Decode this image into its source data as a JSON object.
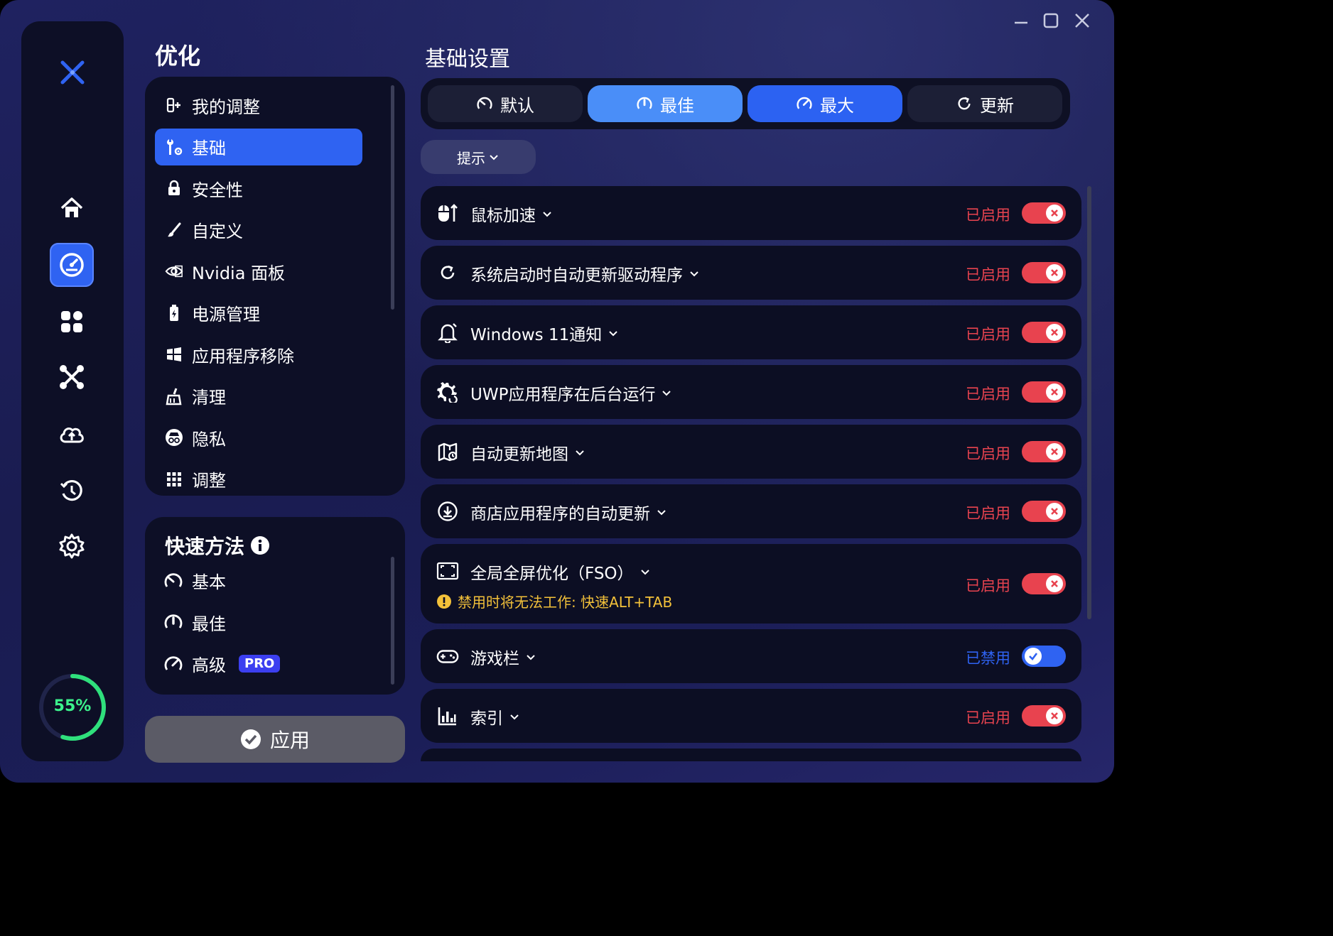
{
  "app": {
    "window_controls": [
      "minimize-icon",
      "maximize-icon",
      "close-icon"
    ],
    "accent_color": "#2f63f2",
    "enabled_color": "#e8434f",
    "disabled_color": "#2f63f2",
    "warning_color": "#f3c13a"
  },
  "rail": {
    "items": [
      "home-icon",
      "speedometer-icon",
      "apps-icon",
      "tools-icon",
      "cloud-icon",
      "restore-icon",
      "settings-icon"
    ],
    "active_item": "speedometer-icon",
    "score_percent": 55,
    "score_label": "55%"
  },
  "optimize": {
    "title": "优化",
    "items": [
      {
        "label": "我的调整",
        "icon": "my-tweaks-icon"
      },
      {
        "label": "基础",
        "icon": "wrench-gear-icon",
        "active": true
      },
      {
        "label": "安全性",
        "icon": "lock-icon"
      },
      {
        "label": "自定义",
        "icon": "brush-icon"
      },
      {
        "label": "Nvidia 面板",
        "icon": "nvidia-icon"
      },
      {
        "label": "电源管理",
        "icon": "battery-icon"
      },
      {
        "label": "应用程序移除",
        "icon": "windows-icon"
      },
      {
        "label": "清理",
        "icon": "broom-icon"
      },
      {
        "label": "隐私",
        "icon": "incognito-icon"
      },
      {
        "label": "调整",
        "icon": "grid-icon"
      }
    ]
  },
  "quick": {
    "title": "快速方法",
    "items": [
      {
        "label": "基本",
        "icon": "gauge-low-icon"
      },
      {
        "label": "最佳",
        "icon": "gauge-mid-icon"
      },
      {
        "label": "高级",
        "icon": "gauge-high-icon",
        "badge": "PRO"
      }
    ]
  },
  "apply_label": "应用",
  "main": {
    "title": "基础设置",
    "presets": [
      {
        "label": "默认",
        "icon": "gauge-low-icon"
      },
      {
        "label": "最佳",
        "icon": "gauge-mid-icon"
      },
      {
        "label": "最大",
        "icon": "gauge-high-icon"
      },
      {
        "label": "更新",
        "icon": "refresh-icon"
      }
    ],
    "tips_label": "提示",
    "settings": [
      {
        "label": "鼠标加速",
        "icon": "mouse-icon",
        "status": "已启用",
        "enabled": true
      },
      {
        "label": "系统启动时自动更新驱动程序",
        "icon": "refresh-icon",
        "status": "已启用",
        "enabled": true
      },
      {
        "label": "Windows 11通知",
        "icon": "bell-icon",
        "status": "已启用",
        "enabled": true
      },
      {
        "label": "UWP应用程序在后台运行",
        "icon": "gear-refresh-icon",
        "status": "已启用",
        "enabled": true
      },
      {
        "label": "自动更新地图",
        "icon": "map-icon",
        "status": "已启用",
        "enabled": true
      },
      {
        "label": "商店应用程序的自动更新",
        "icon": "download-icon",
        "status": "已启用",
        "enabled": true
      },
      {
        "label": "全局全屏优化（FSO）",
        "icon": "fullscreen-icon",
        "status": "已启用",
        "enabled": true,
        "warning": "禁用时将无法工作: 快速ALT+TAB"
      },
      {
        "label": "游戏栏",
        "icon": "gamepad-icon",
        "status": "已禁用",
        "enabled": false
      },
      {
        "label": "索引",
        "icon": "chart-icon",
        "status": "已启用",
        "enabled": true
      }
    ]
  }
}
